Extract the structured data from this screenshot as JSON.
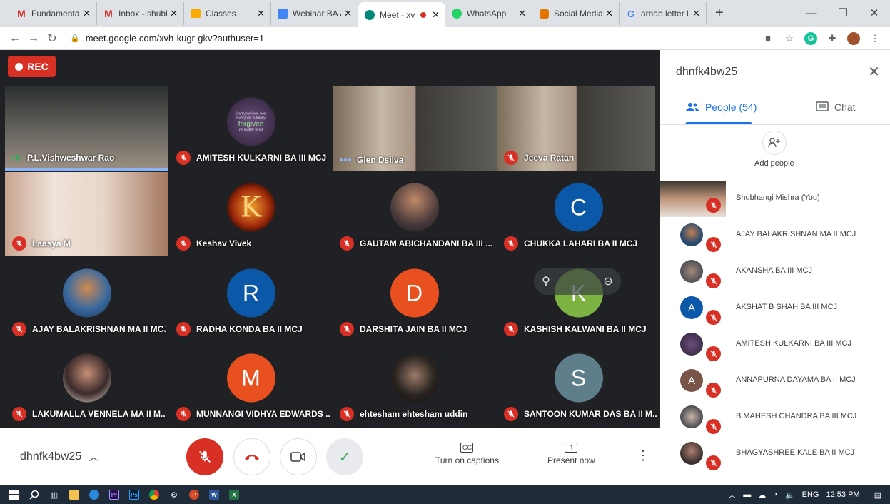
{
  "browser": {
    "tabs": [
      {
        "title": "Fundamentals",
        "icon": "gmail-icon",
        "active": false
      },
      {
        "title": "Inbox - shubh",
        "icon": "gmail-icon",
        "active": false
      },
      {
        "title": "Classes",
        "icon": "classroom-icon",
        "active": false
      },
      {
        "title": "Webinar BA &",
        "icon": "docs-icon",
        "active": false
      },
      {
        "title": "Meet - xv",
        "icon": "meet-icon",
        "active": true
      },
      {
        "title": "WhatsApp",
        "icon": "whatsapp-icon",
        "active": false
      },
      {
        "title": "Social Media I",
        "icon": "site-icon",
        "active": false
      },
      {
        "title": "arnab letter lin",
        "icon": "google-icon",
        "active": false
      }
    ],
    "url": "meet.google.com/xvh-kugr-gkv?authuser=1",
    "new_tab": "+"
  },
  "meeting": {
    "rec_label": "REC",
    "code": "dhnfk4bw25",
    "tiles": [
      {
        "name": "P.L.Vishweshwar Rao",
        "type": "video",
        "status": "speaking"
      },
      {
        "name": "AMITESH KULKARNI BA III MCJ",
        "type": "avatar-image",
        "status": "muted"
      },
      {
        "name": "Glen Dsilva",
        "type": "video",
        "status": "dots"
      },
      {
        "name": "Jeeva Ratan",
        "type": "video",
        "status": "muted"
      },
      {
        "name": "Laasya M",
        "type": "video",
        "status": "muted"
      },
      {
        "name": "Keshav Vivek",
        "type": "avatar-image",
        "status": "muted",
        "letter": "K"
      },
      {
        "name": "GAUTAM ABICHANDANI BA III ...",
        "type": "avatar-image",
        "status": "muted"
      },
      {
        "name": "CHUKKA LAHARI BA II MCJ",
        "type": "letter",
        "letter": "C",
        "color": "#0b57a8",
        "status": "muted"
      },
      {
        "name": "AJAY BALAKRISHNAN MA II MCJ",
        "type": "avatar-image",
        "status": "muted"
      },
      {
        "name": "RADHA KONDA BA II MCJ",
        "type": "letter",
        "letter": "R",
        "color": "#0b57a8",
        "status": "muted"
      },
      {
        "name": "DARSHITA JAIN BA II MCJ",
        "type": "letter",
        "letter": "D",
        "color": "#e8501f",
        "status": "muted"
      },
      {
        "name": "KASHISH KALWANI BA II MCJ",
        "type": "letter",
        "letter": "K",
        "color": "#7cb342",
        "status": "muted"
      },
      {
        "name": "LAKUMALLA VENNELA MA II M...",
        "type": "avatar-image",
        "status": "muted"
      },
      {
        "name": "MUNNANGI VIDHYA EDWARDS ...",
        "type": "letter",
        "letter": "M",
        "color": "#e8501f",
        "status": "muted"
      },
      {
        "name": "ehtesham ehtesham uddin",
        "type": "avatar-image",
        "status": "muted"
      },
      {
        "name": "SANTOON KUMAR DAS BA II M...",
        "type": "letter",
        "letter": "S",
        "color": "#5f7e8c",
        "status": "muted"
      }
    ],
    "amitesh_image_text": {
      "line1": "Start your lives over",
      "line2": "Everyone is totally",
      "word": "forgiven",
      "line3": "no matter what"
    },
    "controls": {
      "captions_label": "Turn on captions",
      "present_label": "Present now",
      "captions_icon": "CC"
    }
  },
  "panel": {
    "title": "dhnfk4bw25",
    "tab_people": "People (54)",
    "tab_chat": "Chat",
    "add_people": "Add people",
    "participants": [
      {
        "name": "Shubhangi Mishra (You)",
        "type": "photo"
      },
      {
        "name": "AJAY BALAKRISHNAN MA II MCJ",
        "type": "photo"
      },
      {
        "name": "AKANSHA BA III MCJ",
        "type": "photo"
      },
      {
        "name": "AKSHAT B SHAH BA III MCJ",
        "type": "letter",
        "letter": "A",
        "color": "#0b57a8"
      },
      {
        "name": "AMITESH KULKARNI BA III MCJ",
        "type": "photo"
      },
      {
        "name": "ANNAPURNA DAYAMA BA II MCJ",
        "type": "letter",
        "letter": "A",
        "color": "#795548"
      },
      {
        "name": "B.MAHESH CHANDRA BA III MCJ",
        "type": "photo"
      },
      {
        "name": "BHAGYASHREE KALE BA II MCJ",
        "type": "photo"
      }
    ]
  },
  "taskbar": {
    "lang": "ENG",
    "time": "12:53 PM"
  }
}
